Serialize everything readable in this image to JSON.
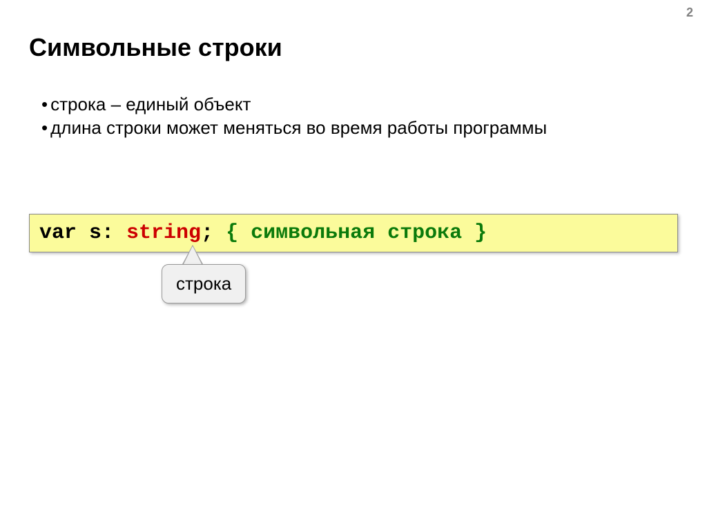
{
  "pageNumber": "2",
  "title": "Символьные строки",
  "bullets": [
    "строка – единый объект",
    "длина строки может меняться во время работы программы"
  ],
  "code": {
    "varKeyword": "var",
    "varName": " s: ",
    "typeKeyword": "string",
    "semicolon": ";",
    "spacer": "   ",
    "commentOpen": "{ ",
    "commentText": "символьная строка",
    "commentClose": " }"
  },
  "callout": "строка"
}
